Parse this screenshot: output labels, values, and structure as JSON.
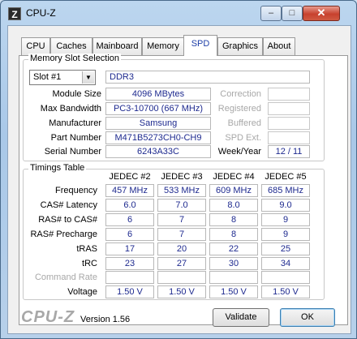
{
  "window": {
    "title": "CPU-Z",
    "app_icon": "Z",
    "controls": {
      "minimize": "–",
      "maximize": "□",
      "close": "✕"
    }
  },
  "tabs": [
    "CPU",
    "Caches",
    "Mainboard",
    "Memory",
    "SPD",
    "Graphics",
    "About"
  ],
  "active_tab": "SPD",
  "slot_section": {
    "legend": "Memory Slot Selection",
    "slot_select": "Slot #1",
    "module_type": "DDR3",
    "rows": [
      {
        "label": "Module Size",
        "value": "4096 MBytes"
      },
      {
        "label": "Max Bandwidth",
        "value": "PC3-10700 (667 MHz)"
      },
      {
        "label": "Manufacturer",
        "value": "Samsung"
      },
      {
        "label": "Part Number",
        "value": "M471B5273CH0-CH9"
      },
      {
        "label": "Serial Number",
        "value": "6243A33C"
      }
    ],
    "right": {
      "correction": "Correction",
      "registered": "Registered",
      "buffered": "Buffered",
      "spd_ext": "SPD Ext.",
      "week_year_label": "Week/Year",
      "week_year_value": "12 / 11"
    }
  },
  "timings": {
    "legend": "Timings Table",
    "columns": [
      "JEDEC #2",
      "JEDEC #3",
      "JEDEC #4",
      "JEDEC #5"
    ],
    "rows": [
      {
        "label": "Frequency",
        "values": [
          "457 MHz",
          "533 MHz",
          "609 MHz",
          "685 MHz"
        ]
      },
      {
        "label": "CAS# Latency",
        "values": [
          "6.0",
          "7.0",
          "8.0",
          "9.0"
        ]
      },
      {
        "label": "RAS# to CAS#",
        "values": [
          "6",
          "7",
          "8",
          "9"
        ]
      },
      {
        "label": "RAS# Precharge",
        "values": [
          "6",
          "7",
          "8",
          "9"
        ]
      },
      {
        "label": "tRAS",
        "values": [
          "17",
          "20",
          "22",
          "25"
        ]
      },
      {
        "label": "tRC",
        "values": [
          "23",
          "27",
          "30",
          "34"
        ]
      },
      {
        "label": "Command Rate",
        "values": [
          "",
          "",
          "",
          ""
        ]
      },
      {
        "label": "Voltage",
        "values": [
          "1.50 V",
          "1.50 V",
          "1.50 V",
          "1.50 V"
        ]
      }
    ]
  },
  "footer": {
    "logo": "CPU-Z",
    "version": "Version 1.56",
    "validate": "Validate",
    "ok": "OK"
  }
}
